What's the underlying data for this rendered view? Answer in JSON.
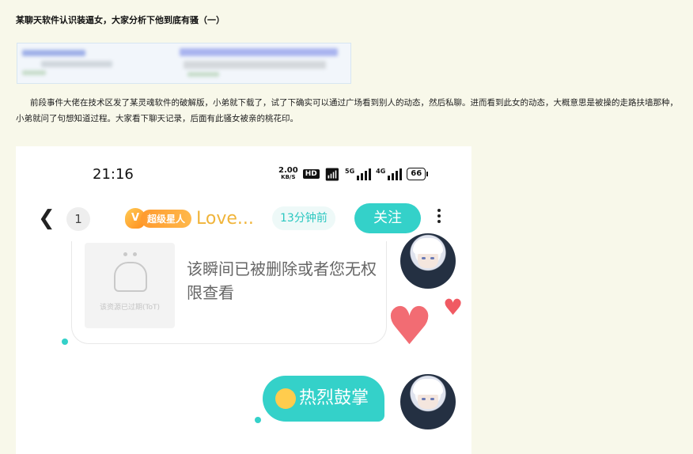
{
  "post": {
    "title": "某聊天软件认识装逼女，大家分析下他到底有骚（一）",
    "body": "前段事件大佬在技术区发了某灵魂软件的破解版，小弟就下载了，试了下确实可以通过广场看到别人的动态，然后私聊。进而看到此女的动态，大概意思是被操的走路扶墙那种，小弟就问了句想知道过程。大家看下聊天记录，后面有此骚女被亲的桃花印。"
  },
  "status": {
    "time": "21:16",
    "net_speed": "2.00",
    "net_unit": "KB/S",
    "hd": "HD",
    "sig1": "5G",
    "sig2": "4G",
    "battery": "66"
  },
  "chat_header": {
    "unread_count": "1",
    "vip_label": "超级星人",
    "name": "Love...",
    "last_active": "13分钟前",
    "follow_label": "关注"
  },
  "messages": {
    "expired_text": "该资源已过期(ToT)",
    "deleted_text": "该瞬间已被删除或者您无权限查看",
    "applause": "热烈鼓掌"
  },
  "colors": {
    "accent": "#34d1c9",
    "vip": "#f0b43a",
    "heart": "#f26c73"
  }
}
